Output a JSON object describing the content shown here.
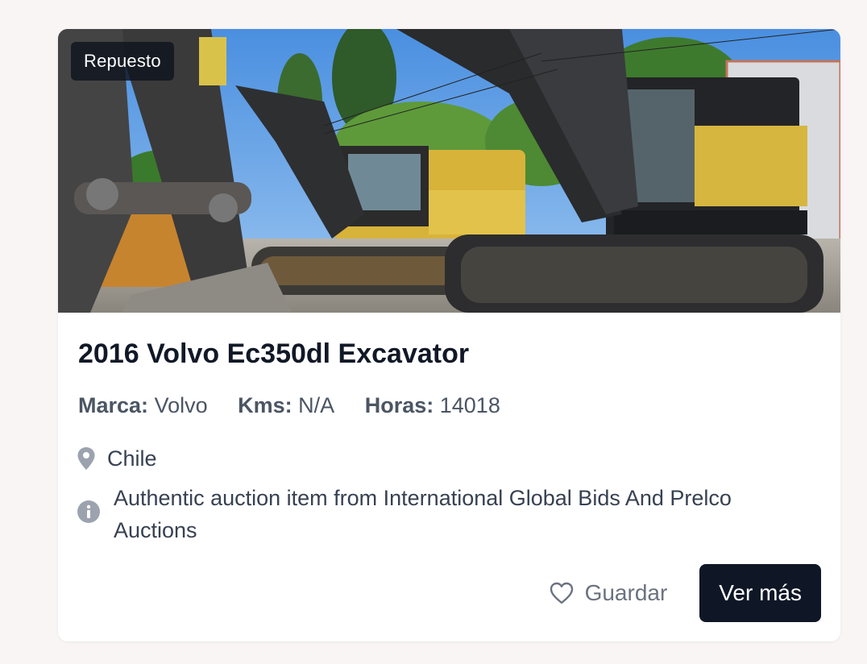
{
  "listing": {
    "badge": "Repuesto",
    "title": "2016 Volvo Ec350dl Excavator",
    "image_description": "photo-excavators",
    "specs": {
      "brand_label": "Marca:",
      "brand_value": "Volvo",
      "kms_label": "Kms:",
      "kms_value": "N/A",
      "hours_label": "Horas:",
      "hours_value": "14018"
    },
    "location": "Chile",
    "info": "Authentic auction item from International Global Bids And Prelco Auctions",
    "save_label": "Guardar",
    "more_label": "Ver más"
  },
  "icons": {
    "location": "map-pin-icon",
    "info": "info-circle-icon",
    "save": "heart-icon"
  },
  "colors": {
    "background": "#f8f5f4",
    "card": "#ffffff",
    "primary_button": "#0f1726",
    "muted_text": "#6b7280"
  }
}
